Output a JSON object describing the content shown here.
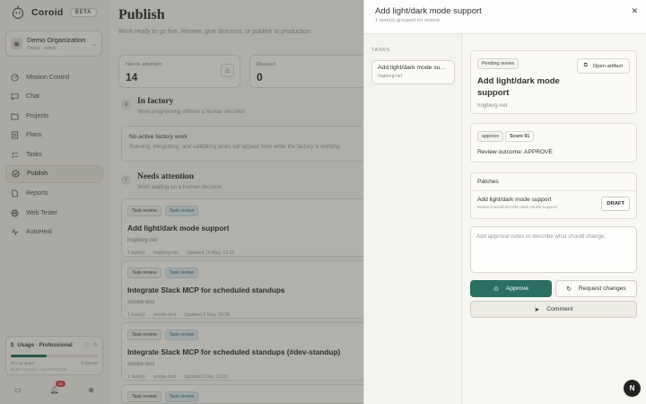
{
  "app": {
    "name": "Coroid",
    "beta": "BETA"
  },
  "org": {
    "name": "Demo Organization",
    "sub": "Owner · admin"
  },
  "nav": [
    {
      "label": "Mission Control",
      "icon": "mission-control-icon"
    },
    {
      "label": "Chat",
      "icon": "chat-icon"
    },
    {
      "label": "Projects",
      "icon": "folder-icon"
    },
    {
      "label": "Plans",
      "icon": "plans-icon"
    },
    {
      "label": "Tasks",
      "icon": "tasks-icon"
    },
    {
      "label": "Publish",
      "icon": "publish-icon"
    },
    {
      "label": "Reports",
      "icon": "reports-icon"
    },
    {
      "label": "Web Tester",
      "icon": "globe-icon"
    },
    {
      "label": "AutoHeal",
      "icon": "autoheal-icon"
    }
  ],
  "usage": {
    "title": "Usage · Professional",
    "spent": "$11.52 spent",
    "limit": "of $39.99",
    "note": "$0.00 estimated · resets 5/7/2026",
    "fraction": 0.41
  },
  "footer": {
    "notifications": "10"
  },
  "page": {
    "title": "Publish",
    "subtitle": "Work ready to go live. Review, give direction, or publish to production."
  },
  "stats": [
    {
      "label": "Needs attention",
      "value": "14"
    },
    {
      "label": "Blocked",
      "value": "0"
    }
  ],
  "factory": {
    "title": "In factory",
    "subtitle": "Work progressing without a human decision",
    "empty_title": "No active factory work",
    "empty_sub": "Running, integrating, and validating lanes will appear here while the factory is working."
  },
  "attention": {
    "title": "Needs attention",
    "subtitle": "Work waiting on a human decision"
  },
  "cards": [
    {
      "chip1": "Task review",
      "chip2": "Task review",
      "title": "Add light/dark mode support",
      "slug": "hogberg-net",
      "count": "1 task(s)",
      "repo": "hogberg-net",
      "updated": "Updated 10 May, 12:29"
    },
    {
      "chip1": "Task review",
      "chip2": "Task review",
      "title": "Integrate Slack MCP for scheduled standups",
      "slug": "smoke-test",
      "count": "1 task(s)",
      "repo": "smoke-test",
      "updated": "Updated 6 May, 00:39"
    },
    {
      "chip1": "Task review",
      "chip2": "Task review",
      "title": "Integrate Slack MCP for scheduled standups (#dev-standup)",
      "slug": "smoke-test",
      "count": "1 task(s)",
      "repo": "smoke-test",
      "updated": "Updated 3 Apr, 13:01"
    },
    {
      "chip1": "Task review",
      "chip2": "Task review",
      "title": "",
      "slug": "",
      "count": "",
      "repo": "",
      "updated": ""
    }
  ],
  "panel": {
    "title": "Add light/dark mode support",
    "subtitle": "1 task(s) grouped for review.",
    "tasks_label": "TASKS",
    "task_item": {
      "title": "Add light/dark mode support",
      "slug": "hogberg-net"
    },
    "status_tag": "Pending review",
    "open_artifact": "Open artifact",
    "detail_title": "Add light/dark mode support",
    "detail_slug": "hogberg-net",
    "review_tag": "approve",
    "score_tag": "Score 91",
    "review_outcome": "Review outcome: APPROVE",
    "patches_label": "Patches",
    "patch_title": "Add light/dark mode support",
    "patch_branch": "feature/coroid-5e74bc-dark-mode-support",
    "draft": "DRAFT",
    "notes_placeholder": "Add approval notes or describe what should change.",
    "approve": "Approve",
    "request_changes": "Request changes",
    "comment": "Comment"
  },
  "fab": "N"
}
